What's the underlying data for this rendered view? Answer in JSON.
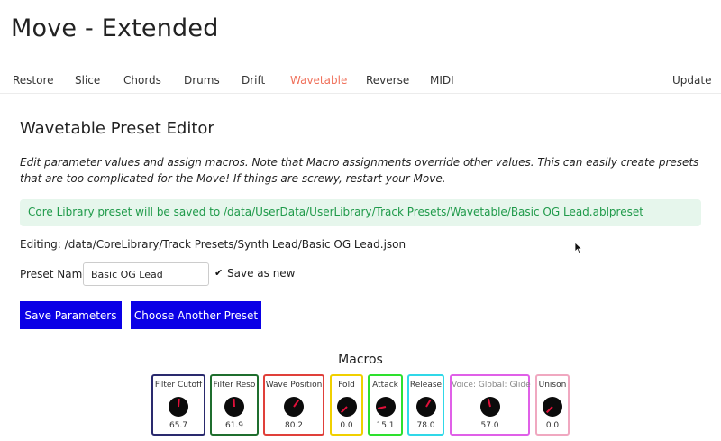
{
  "app": {
    "title": "Move - Extended"
  },
  "nav": {
    "items": [
      {
        "label": "Restore"
      },
      {
        "label": "Slice"
      },
      {
        "label": "Chords"
      },
      {
        "label": "Drums"
      },
      {
        "label": "Drift"
      },
      {
        "label": "Wavetable",
        "active": true
      },
      {
        "label": "Reverse"
      },
      {
        "label": "MIDI"
      }
    ],
    "update_label": "Update"
  },
  "editor": {
    "title": "Wavetable Preset Editor",
    "description": "Edit parameter values and assign macros. Note that Macro assignments override other values. This can easily create presets that are too complicated for the Move! If things are screwy, restart your Move.",
    "notice": "Core Library preset will be saved to /data/UserData/UserLibrary/Track Presets/Wavetable/Basic OG Lead.ablpreset",
    "editing": "Editing: /data/CoreLibrary/Track Presets/Synth Lead/Basic OG Lead.json",
    "preset_name_label": "Preset Name:",
    "preset_name_value": "Basic OG Lead",
    "save_as_new_label": "Save as new",
    "save_as_new_checked": true,
    "save_button": "Save Parameters",
    "choose_button": "Choose Another Preset"
  },
  "macros": {
    "title": "Macros",
    "items": [
      {
        "label": "Filter Cutoff",
        "value": "65.7",
        "color": "#2a2a6e"
      },
      {
        "label": "Filter Reso",
        "value": "61.9",
        "color": "#1f6e2e"
      },
      {
        "label": "Wave Position",
        "value": "80.2",
        "color": "#e0403a"
      },
      {
        "label": "Fold",
        "value": "0.0",
        "color": "#f0d000"
      },
      {
        "label": "Attack",
        "value": "15.1",
        "color": "#2ee02e"
      },
      {
        "label": "Release",
        "value": "78.0",
        "color": "#30d8e8"
      },
      {
        "label": "Voice: Global: Glide",
        "value": "57.0",
        "color": "#e060e8"
      },
      {
        "label": "Unison",
        "value": "0.0",
        "color": "#f0a8c0"
      }
    ]
  },
  "colors": {
    "accent_active_tab": "#f0705a",
    "button_bg": "#0a00e6",
    "notice_bg": "#e6f6ec",
    "notice_text": "#1f9a4a",
    "knob_pointer": "#e0103a"
  }
}
